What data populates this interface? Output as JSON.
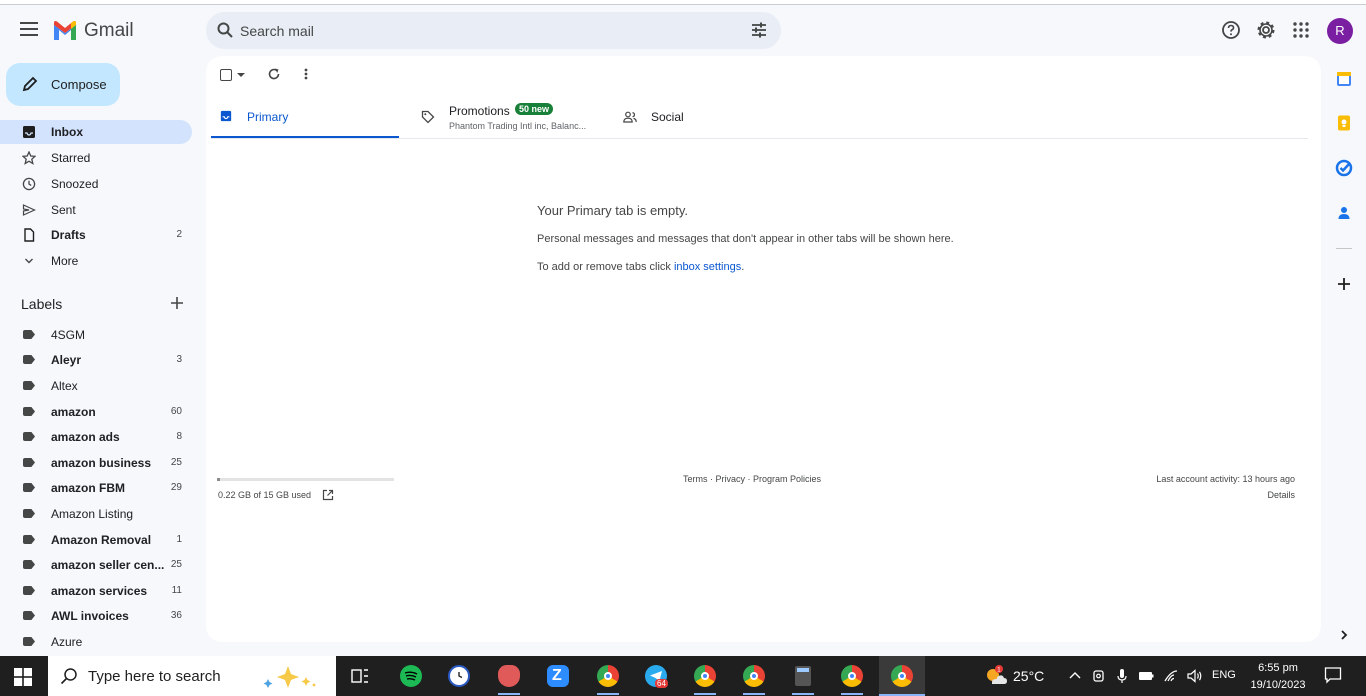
{
  "app": {
    "logo_text": "Gmail",
    "brand_colors": {
      "red": "#ea4335",
      "blue": "#4285f4",
      "green": "#34a853",
      "yellow": "#fbbc04"
    }
  },
  "search": {
    "placeholder": "Search mail"
  },
  "header": {
    "avatar_letter": "R"
  },
  "compose": {
    "label": "Compose"
  },
  "nav": [
    {
      "label": "Inbox",
      "count": "",
      "icon": "inbox-icon",
      "bold": true,
      "active": true
    },
    {
      "label": "Starred",
      "count": "",
      "icon": "star-icon",
      "bold": false
    },
    {
      "label": "Snoozed",
      "count": "",
      "icon": "clock-icon",
      "bold": false
    },
    {
      "label": "Sent",
      "count": "",
      "icon": "send-icon",
      "bold": false
    },
    {
      "label": "Drafts",
      "count": "2",
      "icon": "draft-icon",
      "bold": true
    },
    {
      "label": "More",
      "count": "",
      "icon": "chevron-down-icon",
      "bold": false
    }
  ],
  "labels_section": {
    "title": "Labels"
  },
  "labels": [
    {
      "label": "4SGM",
      "count": "",
      "bold": false
    },
    {
      "label": "Aleyr",
      "count": "3",
      "bold": true
    },
    {
      "label": "Altex",
      "count": "",
      "bold": false
    },
    {
      "label": "amazon",
      "count": "60",
      "bold": true
    },
    {
      "label": "amazon ads",
      "count": "8",
      "bold": true
    },
    {
      "label": "amazon business",
      "count": "25",
      "bold": true
    },
    {
      "label": "amazon FBM",
      "count": "29",
      "bold": true
    },
    {
      "label": "Amazon Listing",
      "count": "",
      "bold": false
    },
    {
      "label": "Amazon Removal",
      "count": "1",
      "bold": true
    },
    {
      "label": "amazon seller cen...",
      "count": "25",
      "bold": true
    },
    {
      "label": "amazon services",
      "count": "11",
      "bold": true
    },
    {
      "label": "AWL invoices",
      "count": "36",
      "bold": true
    },
    {
      "label": "Azure",
      "count": "",
      "bold": false
    }
  ],
  "tabs": {
    "primary": {
      "label": "Primary"
    },
    "promotions": {
      "label": "Promotions",
      "badge": "50 new",
      "snippet": "Phantom Trading Intl inc, Balanc..."
    },
    "social": {
      "label": "Social"
    }
  },
  "empty": {
    "heading": "Your Primary tab is empty.",
    "line1": "Personal messages and messages that don't appear in other tabs will be shown here.",
    "line2_prefix": "To add or remove tabs click ",
    "line2_link": "inbox settings",
    "line2_suffix": "."
  },
  "footer": {
    "storage_text": "0.22 GB of 15 GB used",
    "storage_fraction": 0.015,
    "links": [
      "Terms",
      "Privacy",
      "Program Policies"
    ],
    "activity": "Last account activity: 13 hours ago",
    "details": "Details"
  },
  "taskbar": {
    "search_placeholder": "Type here to search",
    "temperature": "25°C",
    "language": "ENG",
    "time": "6:55 pm",
    "date": "19/10/2023",
    "weather_badge": "1",
    "telegram_badge": "64"
  }
}
